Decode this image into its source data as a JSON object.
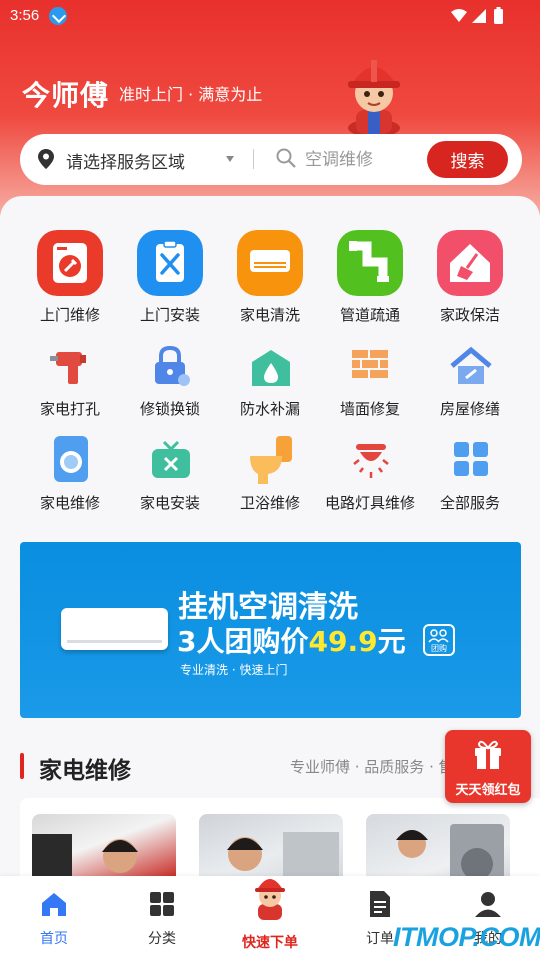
{
  "status_bar": {
    "time": "3:56"
  },
  "header": {
    "brand": "今师傅",
    "slogan": "准时上门 · 满意为止"
  },
  "search": {
    "region_label": "请选择服务区域",
    "placeholder": "空调维修",
    "button_label": "搜索"
  },
  "services": {
    "row1": [
      {
        "label": "上门维修",
        "icon": "washing-machine-wrench-icon",
        "color": "#ea3b2a"
      },
      {
        "label": "上门安装",
        "icon": "clipboard-tools-icon",
        "color": "#1f8ff0"
      },
      {
        "label": "家电清洗",
        "icon": "air-conditioner-icon",
        "color": "#f7930d"
      },
      {
        "label": "管道疏通",
        "icon": "pipe-icon",
        "color": "#52c11f"
      },
      {
        "label": "家政保洁",
        "icon": "house-broom-icon",
        "color": "#f2506a"
      }
    ],
    "row2": [
      {
        "label": "家电打孔",
        "icon": "drill-icon"
      },
      {
        "label": "修锁换锁",
        "icon": "lock-icon"
      },
      {
        "label": "防水补漏",
        "icon": "waterproof-icon"
      },
      {
        "label": "墙面修复",
        "icon": "brick-wall-icon"
      },
      {
        "label": "房屋修缮",
        "icon": "house-repair-icon"
      }
    ],
    "row3": [
      {
        "label": "家电维修",
        "icon": "washer-icon"
      },
      {
        "label": "家电安装",
        "icon": "tv-install-icon"
      },
      {
        "label": "卫浴维修",
        "icon": "toilet-icon"
      },
      {
        "label": "电路灯具维修",
        "icon": "ceiling-lamp-icon"
      },
      {
        "label": "全部服务",
        "icon": "grid-icon"
      }
    ]
  },
  "banner": {
    "title": "挂机空调清洗",
    "price_prefix": "3人团购价",
    "price_value": "49.9",
    "price_suffix": "元",
    "subtitle": "专业清洗 · 快速上门",
    "badge": "团购"
  },
  "section": {
    "title": "家电维修",
    "subtitle": "专业师傅 · 品质服务 · 售后无忧"
  },
  "red_packet": {
    "label": "天天领红包"
  },
  "tabs": [
    {
      "label": "首页",
      "icon": "home-icon"
    },
    {
      "label": "分类",
      "icon": "category-icon"
    },
    {
      "label": "快速下单",
      "icon": "mascot-icon"
    },
    {
      "label": "订单",
      "icon": "order-icon"
    },
    {
      "label": "我的",
      "icon": "user-icon"
    }
  ],
  "watermark": "ITMOP.COM",
  "colors": {
    "brand_red": "#d7261f",
    "tab_active": "#3478f6",
    "banner_blue": "#0a8ee0"
  }
}
